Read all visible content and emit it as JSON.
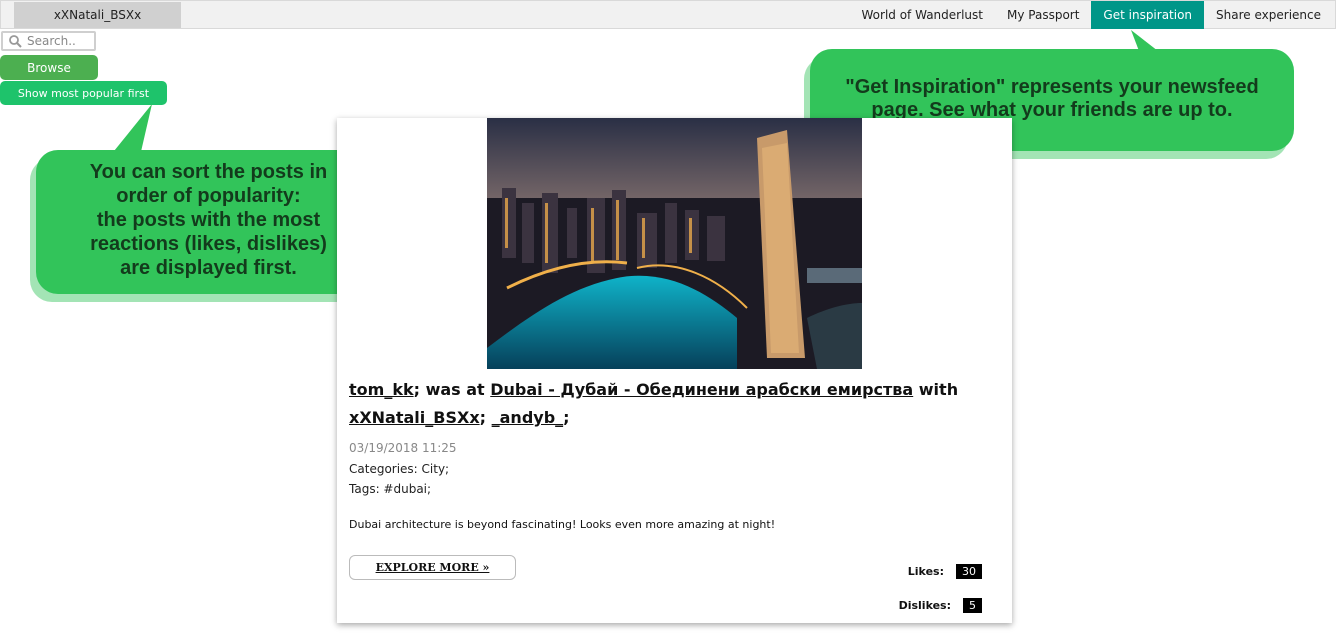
{
  "header": {
    "username": "xXNatali_BSXx",
    "nav": [
      {
        "label": "World of Wanderlust",
        "active": false
      },
      {
        "label": "My Passport",
        "active": false
      },
      {
        "label": "Get inspiration",
        "active": true
      },
      {
        "label": "Share experience",
        "active": false
      }
    ]
  },
  "sidebar": {
    "search_placeholder": "Search..",
    "browse_label": "Browse",
    "popular_label": "Show most popular first"
  },
  "callouts": {
    "sort": [
      "You can sort the posts in",
      "order of popularity:",
      "the posts with the most",
      "reactions (likes, dislikes)",
      "are displayed first."
    ],
    "inspiration": [
      "\"Get Inspiration\" represents your newsfeed",
      "page. See what your friends are up to."
    ]
  },
  "post": {
    "author": "tom_kk",
    "was_at": "; was at ",
    "location": "Dubai - Дубай - Обединени арабски емирства",
    "with": " with",
    "companion1": "xXNatali_BSXx",
    "sep": ";",
    "companion2": "_andyb_",
    "end": ";",
    "date": "03/19/2018 11:25",
    "categories": "Categories: City;",
    "tags": "Tags: #dubai;",
    "description": "Dubai architecture is beyond fascinating! Looks even more amazing at night!",
    "explore_label": "EXPLORE MORE »",
    "likes_label": "Likes:",
    "likes": "30",
    "dislikes_label": "Dislikes:",
    "dislikes": "5"
  },
  "colors": {
    "nav_active": "#009688",
    "browse": "#4caf50",
    "popular": "#1ec36b",
    "callout": "#32c45a"
  }
}
